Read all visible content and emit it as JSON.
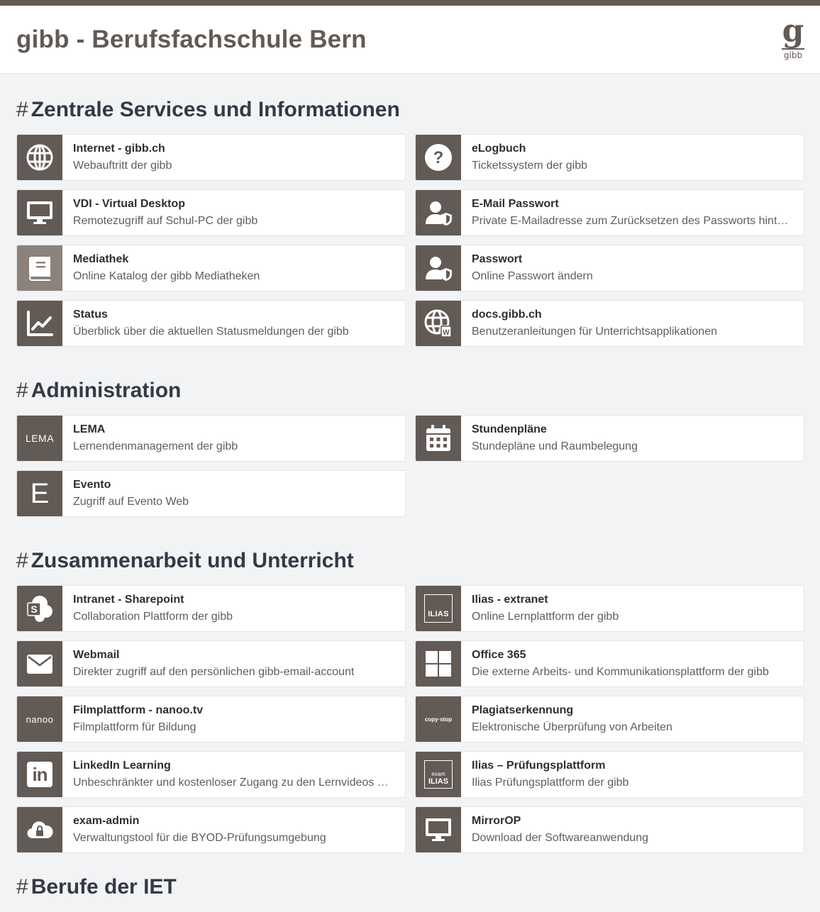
{
  "header": {
    "title": "gibb - Berufsfachschule Bern",
    "logo_glyph": "g",
    "logo_text": "gibb"
  },
  "colors": {
    "brand": "#625a55",
    "background": "#f2f3f4",
    "tile": "#ffffff"
  },
  "sections": [
    {
      "hash": "#",
      "title": "Zentrale Services und Informationen",
      "tiles": [
        {
          "title": "Internet - gibb.ch",
          "subtitle": "Webauftritt der gibb",
          "icon": "globe-icon"
        },
        {
          "title": "eLogbuch",
          "subtitle": "Ticketssystem der gibb",
          "icon": "question-icon"
        },
        {
          "title": "VDI - Virtual Desktop",
          "subtitle": "Remotezugriff auf Schul-PC der gibb",
          "icon": "monitor-icon"
        },
        {
          "title": "E-Mail Passwort",
          "subtitle": "Private E-Mailadresse zum Zurücksetzen des Passworts hinterlegen",
          "icon": "user-shield-icon"
        },
        {
          "title": "Mediathek",
          "subtitle": "Online Katalog der gibb Mediatheken",
          "icon": "book-icon"
        },
        {
          "title": "Passwort",
          "subtitle": "Online Passwort ändern",
          "icon": "user-shield-icon"
        },
        {
          "title": "Status",
          "subtitle": "Überblick über die aktuellen Statusmeldungen der gibb",
          "icon": "chart-line-icon"
        },
        {
          "title": "docs.gibb.ch",
          "subtitle": "Benutzeranleitungen für Unterrichtsapplikationen",
          "icon": "globe-doc-icon"
        }
      ]
    },
    {
      "hash": "#",
      "title": "Administration",
      "tiles": [
        {
          "title": "LEMA",
          "subtitle": "Lernendenmanagement der gibb",
          "icon": "lema-logo",
          "logo_text": "LEMA"
        },
        {
          "title": "Stundenpläne",
          "subtitle": "Stundepläne und Raumbelegung",
          "icon": "calendar-icon"
        },
        {
          "title": "Evento",
          "subtitle": "Zugriff auf Evento Web",
          "icon": "evento-logo",
          "logo_text": "E"
        }
      ]
    },
    {
      "hash": "#",
      "title": "Zusammenarbeit und Unterricht",
      "tiles": [
        {
          "title": "Intranet - Sharepoint",
          "subtitle": "Collaboration Plattform der gibb",
          "icon": "sharepoint-icon",
          "logo_text": "S"
        },
        {
          "title": "Ilias - extranet",
          "subtitle": "Online Lernplattform der gibb",
          "icon": "ilias-logo",
          "logo_text": "ILIAS"
        },
        {
          "title": "Webmail",
          "subtitle": "Direkter zugriff auf den persönlichen gibb-email-account",
          "icon": "envelope-icon"
        },
        {
          "title": "Office 365",
          "subtitle": "Die externe Arbeits- und Kommunikationsplattform der gibb",
          "icon": "windows-icon"
        },
        {
          "title": "Filmplattform - nanoo.tv",
          "subtitle": "Filmplattform für Bildung",
          "icon": "nanoo-logo",
          "logo_text": "nanoo"
        },
        {
          "title": "Plagiatserkennung",
          "subtitle": "Elektronische Überprüfung von Arbeiten",
          "icon": "copy-stop-logo",
          "logo_text": "copy·stop"
        },
        {
          "title": "LinkedIn Learning",
          "subtitle": "Unbeschränkter und kostenloser Zugang zu den Lernvideos von LinkedIn Learning",
          "icon": "linkedin-icon",
          "logo_text": "in"
        },
        {
          "title": "Ilias – Prüfungsplattform",
          "subtitle": "Ilias Prüfungsplattform der gibb",
          "icon": "exam-ilias-logo",
          "logo_text": "exam",
          "logo_text2": "ILIAS"
        },
        {
          "title": "exam-admin",
          "subtitle": "Verwaltungstool für die BYOD-Prüfungsumgebung",
          "icon": "cloud-lock-icon"
        },
        {
          "title": "MirrorOP",
          "subtitle": "Download der Softwareanwendung",
          "icon": "monitor-icon"
        }
      ]
    },
    {
      "hash": "#",
      "title": "Berufe der IET",
      "tiles": []
    }
  ]
}
